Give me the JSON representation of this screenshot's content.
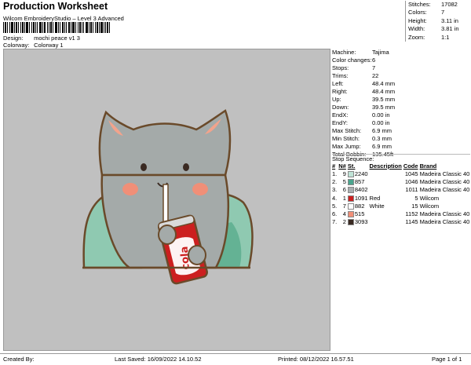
{
  "header": {
    "title": "Production Worksheet",
    "subtitle": "Wilcom EmbroideryStudio – Level 3 Advanced",
    "design_label": "Design:",
    "design_value": "mochi peace v1 3",
    "colorway_label": "Colorway:",
    "colorway_value": "Colorway 1"
  },
  "summary": [
    {
      "key": "Stitches:",
      "value": "17082"
    },
    {
      "key": "Colors:",
      "value": "7"
    },
    {
      "key": "Height:",
      "value": "3.11 in"
    },
    {
      "key": "Width:",
      "value": "3.81 in"
    },
    {
      "key": "Zoom:",
      "value": "1:1"
    }
  ],
  "specs": [
    {
      "key": "Machine:",
      "value": "Tajima"
    },
    {
      "key": "Color changes:",
      "value": "6"
    },
    {
      "key": "Stops:",
      "value": "7"
    },
    {
      "key": "Trims:",
      "value": "22"
    },
    {
      "key": "Left:",
      "value": "48.4 mm"
    },
    {
      "key": "Right:",
      "value": "48.4 mm"
    },
    {
      "key": "Up:",
      "value": "39.5 mm"
    },
    {
      "key": "Down:",
      "value": "39.5 mm"
    },
    {
      "key": "EndX:",
      "value": "0.00 in"
    },
    {
      "key": "EndY:",
      "value": "0.00 in"
    },
    {
      "key": "Max Stitch:",
      "value": "6.9 mm"
    },
    {
      "key": "Min Stitch:",
      "value": "0.3 mm"
    },
    {
      "key": "Max Jump:",
      "value": "6.9 mm"
    },
    {
      "key": "Total Bobbin:",
      "value": "135.45ft"
    }
  ],
  "stop_sequence": {
    "title": "Stop Sequence:",
    "headers": [
      "#",
      "N#",
      "St.",
      "Description",
      "Code",
      "Brand"
    ],
    "rows": [
      {
        "n": "1.",
        "nn": "9",
        "color": "#bfe3d6",
        "st": "2240",
        "desc": "",
        "code": "1045",
        "brand": "Madeira Classic 40"
      },
      {
        "n": "2.",
        "nn": "5",
        "color": "#4aa58e",
        "st": "857",
        "desc": "",
        "code": "1046",
        "brand": "Madeira Classic 40"
      },
      {
        "n": "3.",
        "nn": "6",
        "color": "#a9aeb0",
        "st": "8402",
        "desc": "",
        "code": "1011",
        "brand": "Madeira Classic 40"
      },
      {
        "n": "4.",
        "nn": "1",
        "color": "#cc1f1f",
        "st": "1091",
        "desc": "Red",
        "code": "5",
        "brand": "Wilcom"
      },
      {
        "n": "5.",
        "nn": "7",
        "color": "#ffffff",
        "st": "882",
        "desc": "White",
        "code": "15",
        "brand": "Wilcom"
      },
      {
        "n": "6.",
        "nn": "4",
        "color": "#f08f78",
        "st": "515",
        "desc": "",
        "code": "1152",
        "brand": "Madeira Classic 40"
      },
      {
        "n": "7.",
        "nn": "2",
        "color": "#3a2a22",
        "st": "3093",
        "desc": "",
        "code": "1145",
        "brand": "Madeira Classic 40"
      }
    ]
  },
  "footer": {
    "created_by": "Created By:",
    "last_saved": "Last Saved: 16/09/2022 14.10.52",
    "printed": "Printed: 08/12/2022 16.57.51",
    "page": "Page 1 of 1"
  }
}
